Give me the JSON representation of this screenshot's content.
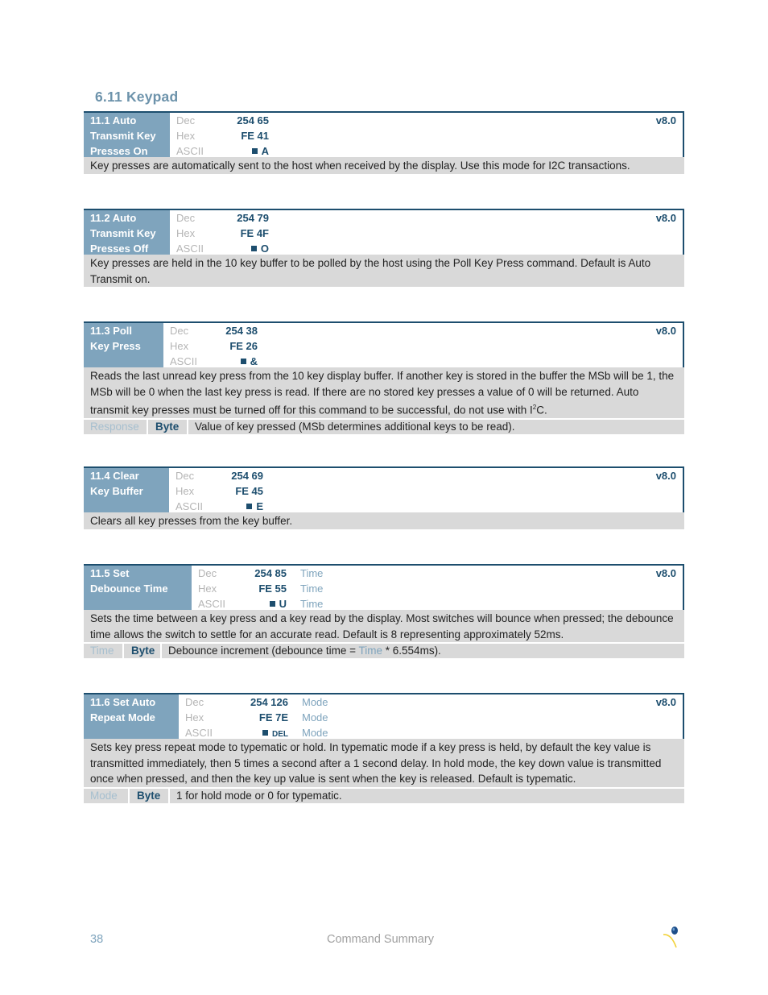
{
  "section": {
    "title": "6.11 Keypad"
  },
  "labels": {
    "dec": "Dec",
    "hex": "Hex",
    "ascii": "ASCII"
  },
  "commands": [
    {
      "name": [
        "11.1 Auto",
        "Transmit Key",
        "Presses On"
      ],
      "dec": "254 65",
      "hex": "FE 41",
      "ascii": "A",
      "version": "v8.0",
      "description": "Key presses are automatically sent to the host when received by the display.  Use this mode for I2C transactions."
    },
    {
      "name": [
        "11.2 Auto",
        "Transmit Key",
        "Presses Off"
      ],
      "dec": "254 79",
      "hex": "FE 4F",
      "ascii": "O",
      "version": "v8.0",
      "description": "Key presses are held in the 10 key buffer to be polled by the host using the Poll Key Press command.  Default is Auto Transmit on."
    },
    {
      "name": [
        "11.3 Poll",
        "Key Press"
      ],
      "dec": "254 38",
      "hex": "FE 26",
      "ascii": "&",
      "version": "v8.0",
      "description_parts": [
        "Reads the last unread key press from the 10 key display buffer.  If another key is stored in the buffer the MSb will be 1, the MSb will be 0 when the last key press is read.  If there are no stored key presses a value of 0 will be returned.  Auto transmit key presses must be turned off for this command to be successful, do not use with I",
        "2",
        "C."
      ],
      "param": {
        "name": "Response",
        "type": "Byte",
        "description": "Value of key pressed (MSb determines additional keys to be read)."
      }
    },
    {
      "name": [
        "11.4 Clear",
        "Key Buffer"
      ],
      "dec": "254 69",
      "hex": "FE 45",
      "ascii": "E",
      "version": "v8.0",
      "description": "Clears all key presses from the key buffer."
    },
    {
      "name": [
        "11.5 Set",
        "Debounce Time"
      ],
      "dec": "254 85",
      "hex": "FE 55",
      "ascii": "U",
      "arg": "Time",
      "version": "v8.0",
      "description": "Sets the time between a key press and a key read by the display.  Most switches will bounce when pressed; the debounce time allows the switch to settle for an accurate read.  Default is 8 representing approximately 52ms.",
      "param": {
        "name": "Time",
        "type": "Byte",
        "description_pre": "Debounce increment (debounce time = ",
        "description_hl": "Time",
        "description_post": " * 6.554ms)."
      }
    },
    {
      "name": [
        "11.6 Set Auto",
        "Repeat Mode"
      ],
      "dec": "254 126",
      "hex": "FE 7E",
      "ascii": "DEL",
      "arg": "Mode",
      "version": "v8.0",
      "description": "Sets key press repeat mode to typematic or hold.  In typematic mode if a key press is held, by default the key value is transmitted immediately, then 5 times a second after a 1 second delay.  In hold mode, the key down value is transmitted once when pressed, and then the key up value is sent when the key is released.  Default is typematic.",
      "param": {
        "name": "Mode",
        "type": "Byte",
        "description": "1 for hold mode or 0 for typematic."
      }
    }
  ],
  "footer": {
    "page_number": "38",
    "title": "Command Summary",
    "logo_icon": "balloon-logo-icon"
  }
}
